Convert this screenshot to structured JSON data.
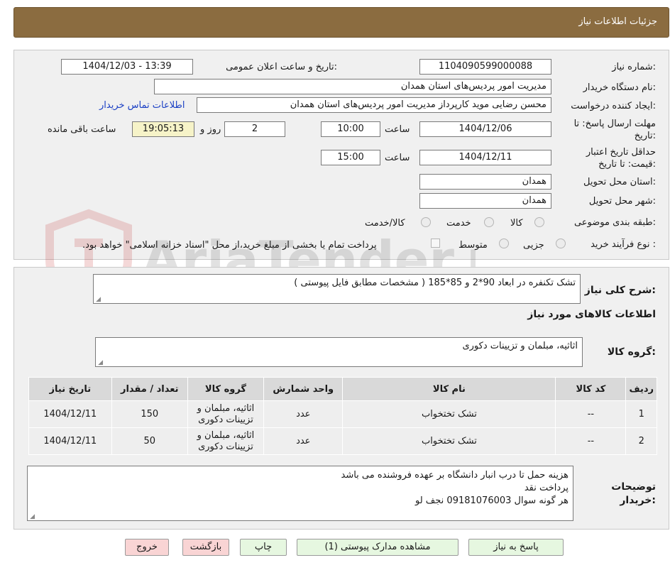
{
  "header": {
    "title": "جزئیات اطلاعات نیاز"
  },
  "form": {
    "need_number_label": "شماره نیاز:",
    "need_number": "1104090599000088",
    "announce_label": "تاریخ و ساعت اعلان عمومی:",
    "announce_value": "1404/12/03 - 13:39",
    "buyer_org_label": "نام دستگاه خریدار:",
    "buyer_org": "مدیریت امور پردیس‌های استان همدان",
    "creator_label": "ایجاد کننده درخواست:",
    "creator": "محسن رضایی موید کارپرداز  مدیریت امور پردیس‌های استان همدان",
    "contact_link": "اطلاعات تماس خریدار",
    "deadline_label": "مهلت ارسال پاسخ: تا تاریخ:",
    "deadline_date": "1404/12/06",
    "time_label": "ساعت",
    "deadline_time": "10:00",
    "days_value": "2",
    "days_label": "روز و",
    "remaining_time": "19:05:13",
    "remaining_label": "ساعت باقی مانده",
    "validity_label": "حداقل تاریخ اعتبار قیمت: تا تاریخ:",
    "validity_date": "1404/12/11",
    "validity_time": "15:00",
    "province_label": "استان محل تحویل:",
    "province": "همدان",
    "city_label": "شهر محل تحویل:",
    "city": "همدان",
    "category_label": "طبقه بندی موضوعی:",
    "category_options": [
      "کالا",
      "خدمت",
      "کالا/خدمت"
    ],
    "process_label": "نوع فرآیند خرید :",
    "process_options": [
      "جزیی",
      "متوسط"
    ],
    "payment_note": "پرداخت تمام یا بخشی از مبلغ خرید،از محل \"اسناد خزانه اسلامی\" خواهد بود."
  },
  "watermark": "AriaTender.net",
  "details": {
    "summary_label": "شرح کلی نیاز:",
    "summary": "تشک تکنفره در ابعاد 90*2 و 85*185 ( مشخصات مطابق فایل پیوستی )",
    "goods_info_title": "اطلاعات کالاهای مورد نیاز",
    "goods_group_label": "گروه کالا:",
    "goods_group": "اثاثیه، مبلمان و تزیینات دکوری",
    "table": {
      "headers": [
        "ردیف",
        "کد کالا",
        "نام کالا",
        "واحد شمارش",
        "گروه کالا",
        "تعداد / مقدار",
        "تاریخ نیاز"
      ],
      "rows": [
        [
          "1",
          "--",
          "تشک تختخواب",
          "عدد",
          "اثاثیه، مبلمان و تزیینات دکوری",
          "150",
          "1404/12/11"
        ],
        [
          "2",
          "--",
          "تشک تختخواب",
          "عدد",
          "اثاثیه، مبلمان و تزیینات دکوری",
          "50",
          "1404/12/11"
        ]
      ]
    },
    "buyer_notes_label": "توضیحات خریدار:",
    "buyer_notes": [
      "هزینه حمل تا درب انبار دانشگاه بر عهده فروشنده می باشد",
      "پرداخت نقد",
      "هر گونه سوال 09181076003 نجف لو"
    ]
  },
  "buttons": {
    "reply": "پاسخ به نیاز",
    "attachments": "مشاهده مدارک پیوستی (1)",
    "print": "چاپ",
    "back": "بازگشت",
    "exit": "خروج"
  }
}
